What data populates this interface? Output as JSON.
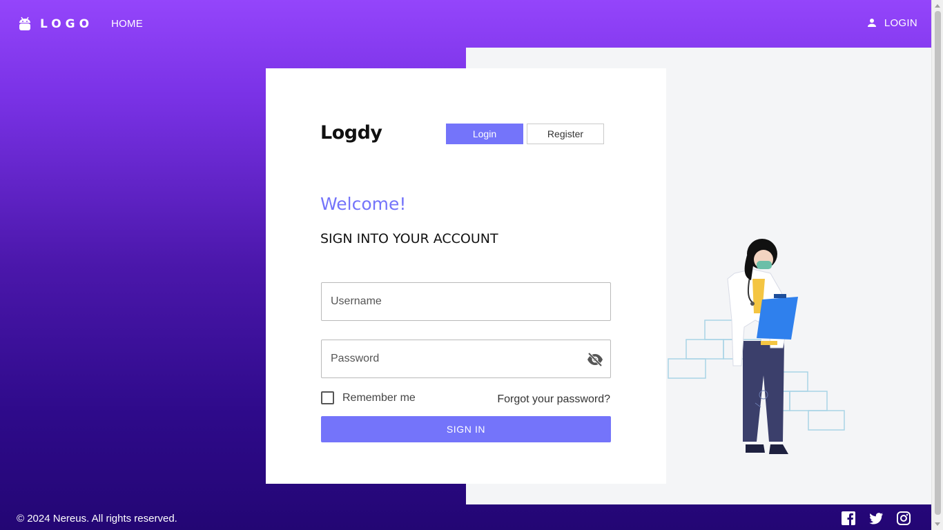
{
  "header": {
    "logo_text": "LOGO",
    "home_label": "HOME",
    "login_label": "LOGIN"
  },
  "card": {
    "brand": "Logdy",
    "tabs": [
      {
        "label": "Login",
        "active": true
      },
      {
        "label": "Register",
        "active": false
      }
    ],
    "welcome": "Welcome!",
    "subtitle": "SIGN INTO YOUR ACCOUNT",
    "username": {
      "placeholder": "Username",
      "value": ""
    },
    "password": {
      "placeholder": "Password",
      "value": "",
      "visibility_icon": "eye-off-icon"
    },
    "remember_label": "Remember me",
    "remember_checked": false,
    "forgot_label": "Forgot your password?",
    "signin_label": "SIGN IN"
  },
  "footer": {
    "copyright": "© 2024 Nereus. All rights reserved.",
    "socials": [
      "facebook-icon",
      "twitter-icon",
      "instagram-icon"
    ]
  },
  "colors": {
    "accent": "#7474fa",
    "header_gradient_top": "#9445fb",
    "header_gradient_bottom": "#230674",
    "panel": "#f4f5f7"
  }
}
